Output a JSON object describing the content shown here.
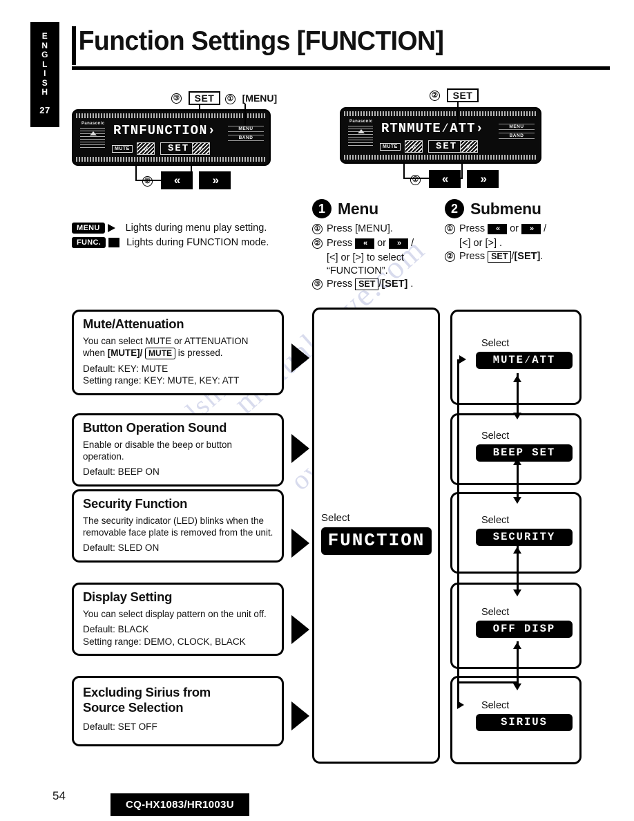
{
  "lang_tab": {
    "letters": [
      "E",
      "N",
      "G",
      "L",
      "I",
      "S",
      "H"
    ],
    "page_ref": "27"
  },
  "header": {
    "title": "Function Settings [FUNCTION]"
  },
  "figures": {
    "left_device": {
      "brand": "Panasonic",
      "display_text": "RTNFUNCTION›",
      "mute_key": "MUTE",
      "set_key": "SET",
      "right_buttons": [
        "MENU",
        "BAND"
      ],
      "callouts": [
        {
          "num": "③",
          "label": "SET",
          "style": "boxed"
        },
        {
          "num": "①",
          "label": "[MENU]",
          "style": "plain"
        },
        {
          "num": "②",
          "label": "« »",
          "style": "keys"
        }
      ]
    },
    "right_device": {
      "brand": "Panasonic",
      "display_text": "RTNMUTE∕ATT›",
      "mute_key": "MUTE",
      "set_key": "SET",
      "right_buttons": [
        "MENU",
        "BAND"
      ],
      "callouts": [
        {
          "num": "②",
          "label": "SET",
          "style": "boxed"
        },
        {
          "num": "①",
          "label": "« »",
          "style": "keys"
        }
      ]
    }
  },
  "legend": [
    {
      "chip": "MENU",
      "chip_style": "filled",
      "text": "Lights during menu play setting."
    },
    {
      "chip": "FUNC.",
      "chip_style": "filled",
      "text": "Lights during FUNCTION mode."
    }
  ],
  "instructions": {
    "menu": {
      "num": "1",
      "title": "Menu",
      "steps": [
        {
          "num": "①",
          "text": "Press [MENU]."
        },
        {
          "num": "②",
          "text": "Press « or » /",
          "cont": [
            "[<] or [>] to select",
            "“FUNCTION”."
          ]
        },
        {
          "num": "③",
          "text": "Press SET /[SET] ."
        }
      ]
    },
    "submenu": {
      "num": "2",
      "title": "Submenu",
      "steps": [
        {
          "num": "①",
          "text": "Press « or » /",
          "cont": [
            "[<] or [>] ."
          ]
        },
        {
          "num": "②",
          "text": "Press SET /[SET]."
        }
      ]
    }
  },
  "settings": [
    {
      "id": "mute-attenuation",
      "title": "Mute/Attenuation",
      "desc_a": "You can select MUTE or ATTENUATION",
      "desc_b_pre": "when ",
      "desc_b_key1": "[MUTE]/",
      "desc_b_chip": "MUTE",
      "desc_b_post": " is pressed.",
      "default": "Default: KEY: MUTE",
      "range": "Setting range: KEY: MUTE, KEY: ATT"
    },
    {
      "id": "button-operation-sound",
      "title": "Button Operation Sound",
      "desc_a": "Enable or disable the beep or button operation.",
      "default": "Default: BEEP ON",
      "range": ""
    },
    {
      "id": "security-function",
      "title": "Security Function",
      "desc_a": "The security indicator (LED) blinks when the",
      "desc_b": "removable face plate is removed from the unit.",
      "default": "Default: SLED ON",
      "range": ""
    },
    {
      "id": "display-setting",
      "title": "Display Setting",
      "desc_a": "You can select display pattern on the unit off.",
      "default": "Default: BLACK",
      "range": "Setting range: DEMO, CLOCK, BLACK"
    },
    {
      "id": "excluding-sirius",
      "title_line1": "Excluding Sirius from",
      "title_line2": "Source Selection",
      "default": "Default: SET OFF",
      "range": ""
    }
  ],
  "center": {
    "select_label": "Select",
    "lcd_text": "FUNCTION"
  },
  "submenu_items": [
    {
      "id": "mute-att",
      "select_label": "Select",
      "lcd_text": "MUTE∕ATT"
    },
    {
      "id": "beep-set",
      "select_label": "Select",
      "lcd_text": "BEEP SET"
    },
    {
      "id": "security",
      "select_label": "Select",
      "lcd_text": "SECURITY"
    },
    {
      "id": "off-disp",
      "select_label": "Select",
      "lcd_text": "OFF DISP"
    },
    {
      "id": "sirius",
      "select_label": "Select",
      "lcd_text": "SIRIUS"
    }
  ],
  "watermark": {
    "line1": "manualshive.com",
    "line2": "manualshive",
    "line3": "ow"
  },
  "footer": {
    "page_number": "54",
    "model": "CQ-HX1083/HR1003U"
  }
}
